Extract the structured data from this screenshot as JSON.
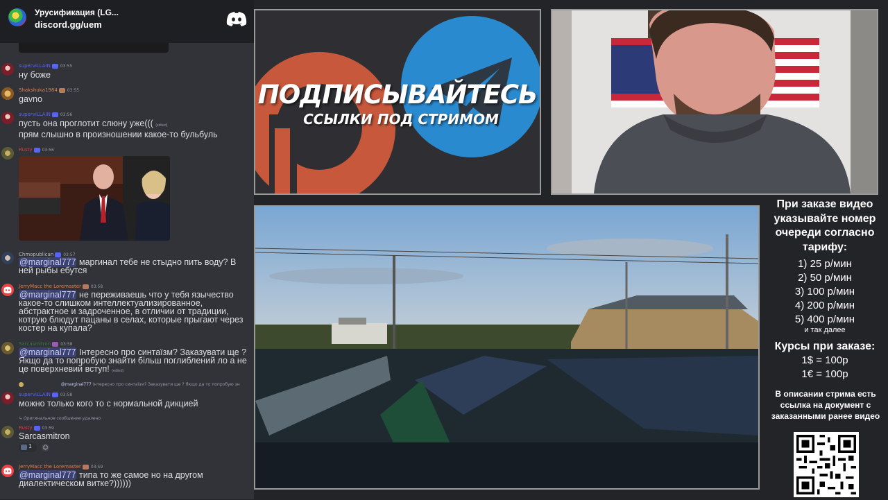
{
  "discord": {
    "server_name": "Урусификация (LG...",
    "invite": "discord.gg/uem"
  },
  "messages": [
    {
      "user": "superviLLAIN",
      "time": "03:55",
      "text": "ну боже"
    },
    {
      "user": "Shakshuka1984",
      "time": "03:55",
      "text": "gavno"
    },
    {
      "user": "superviLLAIN",
      "time": "03:56",
      "text_1": "пусть она проглотит слюну уже(((",
      "edited": "(edited)",
      "text_2": "прям слышно в произношении какое-то бульбуль"
    },
    {
      "user": "Rusty",
      "time": "03:56"
    },
    {
      "user": "Chmopublican",
      "time": "03:57",
      "mention": "@marginal777",
      "text": "маргинал тебе не стыдно пить воду? В ней рыбы ебутся"
    },
    {
      "user": "JerryMacc the Loremaster",
      "time": "03:58",
      "mention": "@marginal777",
      "text": "не переживаешь что у тебя язычество какое-то слишком интеллектуализированное, абстрактное и задроченное, в отличии от традиции, котрую блюдут пацаны в селах, которые прыгают через костер на купала?"
    },
    {
      "user": "Sarcasmitron",
      "time": "03:58",
      "mention": "@marginal777",
      "text": "Інтересно про синтаїзм? Заказувати ще ? Якщо да то попробую знайти більш поглиблений ло а не це поверхневий вступ!",
      "edited": "(edited)"
    },
    {
      "reply_user": "@marginal777",
      "reply_text": "Інтересно про синтаїзм? Заказувати ще ? Якщо да то попробую зн",
      "user": "superviLLAIN",
      "time": "03:58",
      "text": "можно только кого то с нормальной дикцией"
    },
    {
      "reply_text": "Оригинальное сообщение удалено",
      "user": "Rusty",
      "time": "03:59",
      "text": "Sarcasmitron",
      "reaction_count": "1"
    },
    {
      "user": "JerryMacc the Loremaster",
      "time": "03:59",
      "mention": "@marginal777",
      "text": "типа то же самое но на другом диалектическом витке?))))))"
    }
  ],
  "promo": {
    "title": "ПОДПИСЫВАЙТЕСЬ",
    "subtitle": "ССЫЛКИ ПОД СТРИМОМ"
  },
  "info": {
    "order_text": "При заказе видео указывайте номер очереди согласно тарифу:",
    "tariffs": [
      "1) 25 р/мин",
      "2) 50 р/мин",
      "3) 100 р/мин",
      "4) 200 р/мин",
      "5) 400 р/мин"
    ],
    "tariff_more": "и так далее",
    "rates_title": "Курсы при заказе:",
    "rate_usd": "1$ = 100р",
    "rate_eur": "1€ = 100р",
    "description": "В описании стрима есть ссылка на документ с заказанными ранее видео"
  },
  "colors": {
    "chat_bg": "#313338",
    "header_bg": "#1e1f22",
    "mention_bg": "#3c4270",
    "telegram_blue": "#2a8ad0",
    "patreon_orange": "#c8583c"
  }
}
